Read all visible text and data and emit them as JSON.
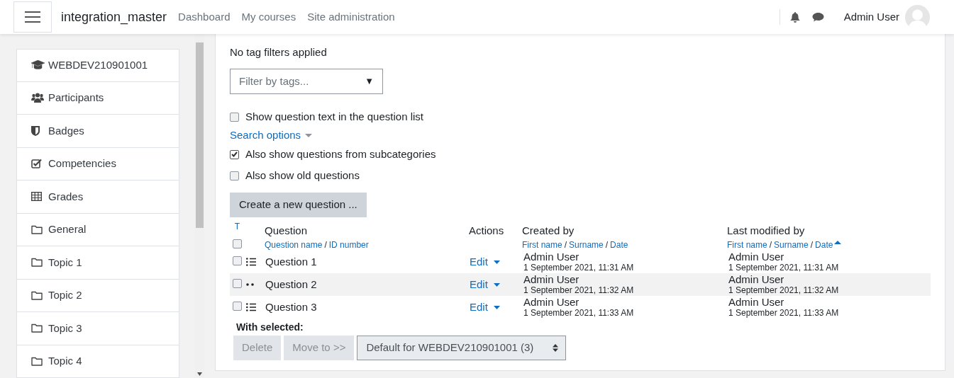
{
  "navbar": {
    "site_name": "integration_master",
    "links": [
      "Dashboard",
      "My courses",
      "Site administration"
    ],
    "user_name": "Admin User"
  },
  "sidebar": {
    "items": [
      {
        "label": "WEBDEV210901001",
        "kind": "course"
      },
      {
        "label": "Participants",
        "kind": "users"
      },
      {
        "label": "Badges",
        "kind": "shield"
      },
      {
        "label": "Competencies",
        "kind": "checkbox"
      },
      {
        "label": "Grades",
        "kind": "table"
      },
      {
        "label": "General",
        "kind": "folder"
      },
      {
        "label": "Topic 1",
        "kind": "folder"
      },
      {
        "label": "Topic 2",
        "kind": "folder"
      },
      {
        "label": "Topic 3",
        "kind": "folder"
      },
      {
        "label": "Topic 4",
        "kind": "folder"
      }
    ]
  },
  "tag_filter": {
    "status": "No tag filters applied",
    "placeholder": "Filter by tags...",
    "arrow": "▼"
  },
  "options": [
    {
      "kind": "checkbox",
      "label": "Show question text in the question list",
      "checked": false
    },
    {
      "kind": "link",
      "label": "Search options"
    },
    {
      "kind": "checkbox",
      "label": "Also show questions from subcategories",
      "checked": true
    },
    {
      "kind": "checkbox",
      "label": "Also show old questions",
      "checked": false
    }
  ],
  "create_button": "Create a new question ...",
  "table": {
    "type_sort": "T",
    "select_all_checked": false,
    "separator": "/",
    "columns": [
      {
        "title": "Question",
        "sort_links": [
          "Question name",
          "ID number"
        ],
        "sorted": false
      },
      {
        "title": "Actions"
      },
      {
        "title": "Created by",
        "sort_links": [
          "First name",
          "Surname",
          "Date"
        ],
        "sorted": false
      },
      {
        "title": "Last modified by",
        "sort_links": [
          "First name",
          "Surname",
          "Date"
        ],
        "sorted": true
      }
    ],
    "rows": [
      {
        "kind": "multichoice",
        "name": "Question 1",
        "action": "Edit",
        "created_by": "Admin User",
        "created": "1 September 2021, 11:31 AM",
        "modified_by": "Admin User",
        "modified": "1 September 2021, 11:31 AM",
        "checked": false,
        "highlighted": false
      },
      {
        "kind": "truefalse",
        "name": "Question 2",
        "action": "Edit",
        "created_by": "Admin User",
        "created": "1 September 2021, 11:32 AM",
        "modified_by": "Admin User",
        "modified": "1 September 2021, 11:32 AM",
        "checked": false,
        "highlighted": true
      },
      {
        "kind": "multichoice",
        "name": "Question 3",
        "action": "Edit",
        "created_by": "Admin User",
        "created": "1 September 2021, 11:33 AM",
        "modified_by": "Admin User",
        "modified": "1 September 2021, 11:33 AM",
        "checked": false,
        "highlighted": false
      }
    ]
  },
  "bulk": {
    "label": "With selected:",
    "buttons": [
      {
        "label": "Delete",
        "disabled": true
      },
      {
        "label": "Move to >>",
        "disabled": true
      }
    ],
    "category": "Default for WEBDEV210901001 (3)"
  }
}
